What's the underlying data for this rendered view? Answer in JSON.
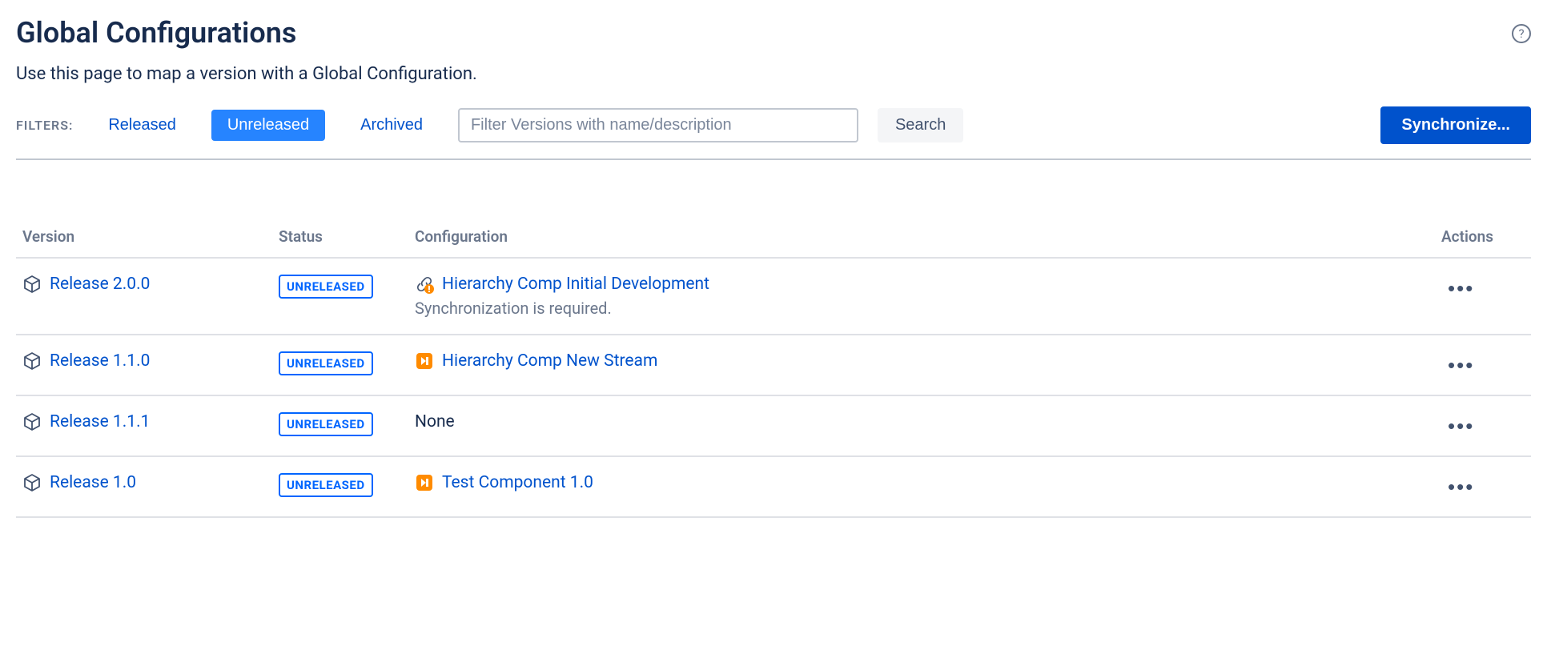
{
  "header": {
    "title": "Global Configurations",
    "subtitle": "Use this page to map a version with a Global Configuration.",
    "help_tooltip": "?"
  },
  "filters": {
    "label": "FILTERS:",
    "released": "Released",
    "unreleased": "Unreleased",
    "archived": "Archived",
    "active": "unreleased"
  },
  "search": {
    "placeholder": "Filter Versions with name/description",
    "button": "Search"
  },
  "sync_button": "Synchronize...",
  "table": {
    "columns": {
      "version": "Version",
      "status": "Status",
      "configuration": "Configuration",
      "actions": "Actions"
    },
    "rows": [
      {
        "version": "Release 2.0.0",
        "status": "UNRELEASED",
        "config_icon": "warn-link",
        "config_name": "Hierarchy Comp Initial Development",
        "config_note": "Synchronization is required."
      },
      {
        "version": "Release 1.1.0",
        "status": "UNRELEASED",
        "config_icon": "stream",
        "config_name": "Hierarchy Comp New Stream",
        "config_note": ""
      },
      {
        "version": "Release 1.1.1",
        "status": "UNRELEASED",
        "config_icon": "",
        "config_name": "None",
        "config_note": ""
      },
      {
        "version": "Release 1.0",
        "status": "UNRELEASED",
        "config_icon": "stream",
        "config_name": "Test Component 1.0",
        "config_note": ""
      }
    ]
  }
}
